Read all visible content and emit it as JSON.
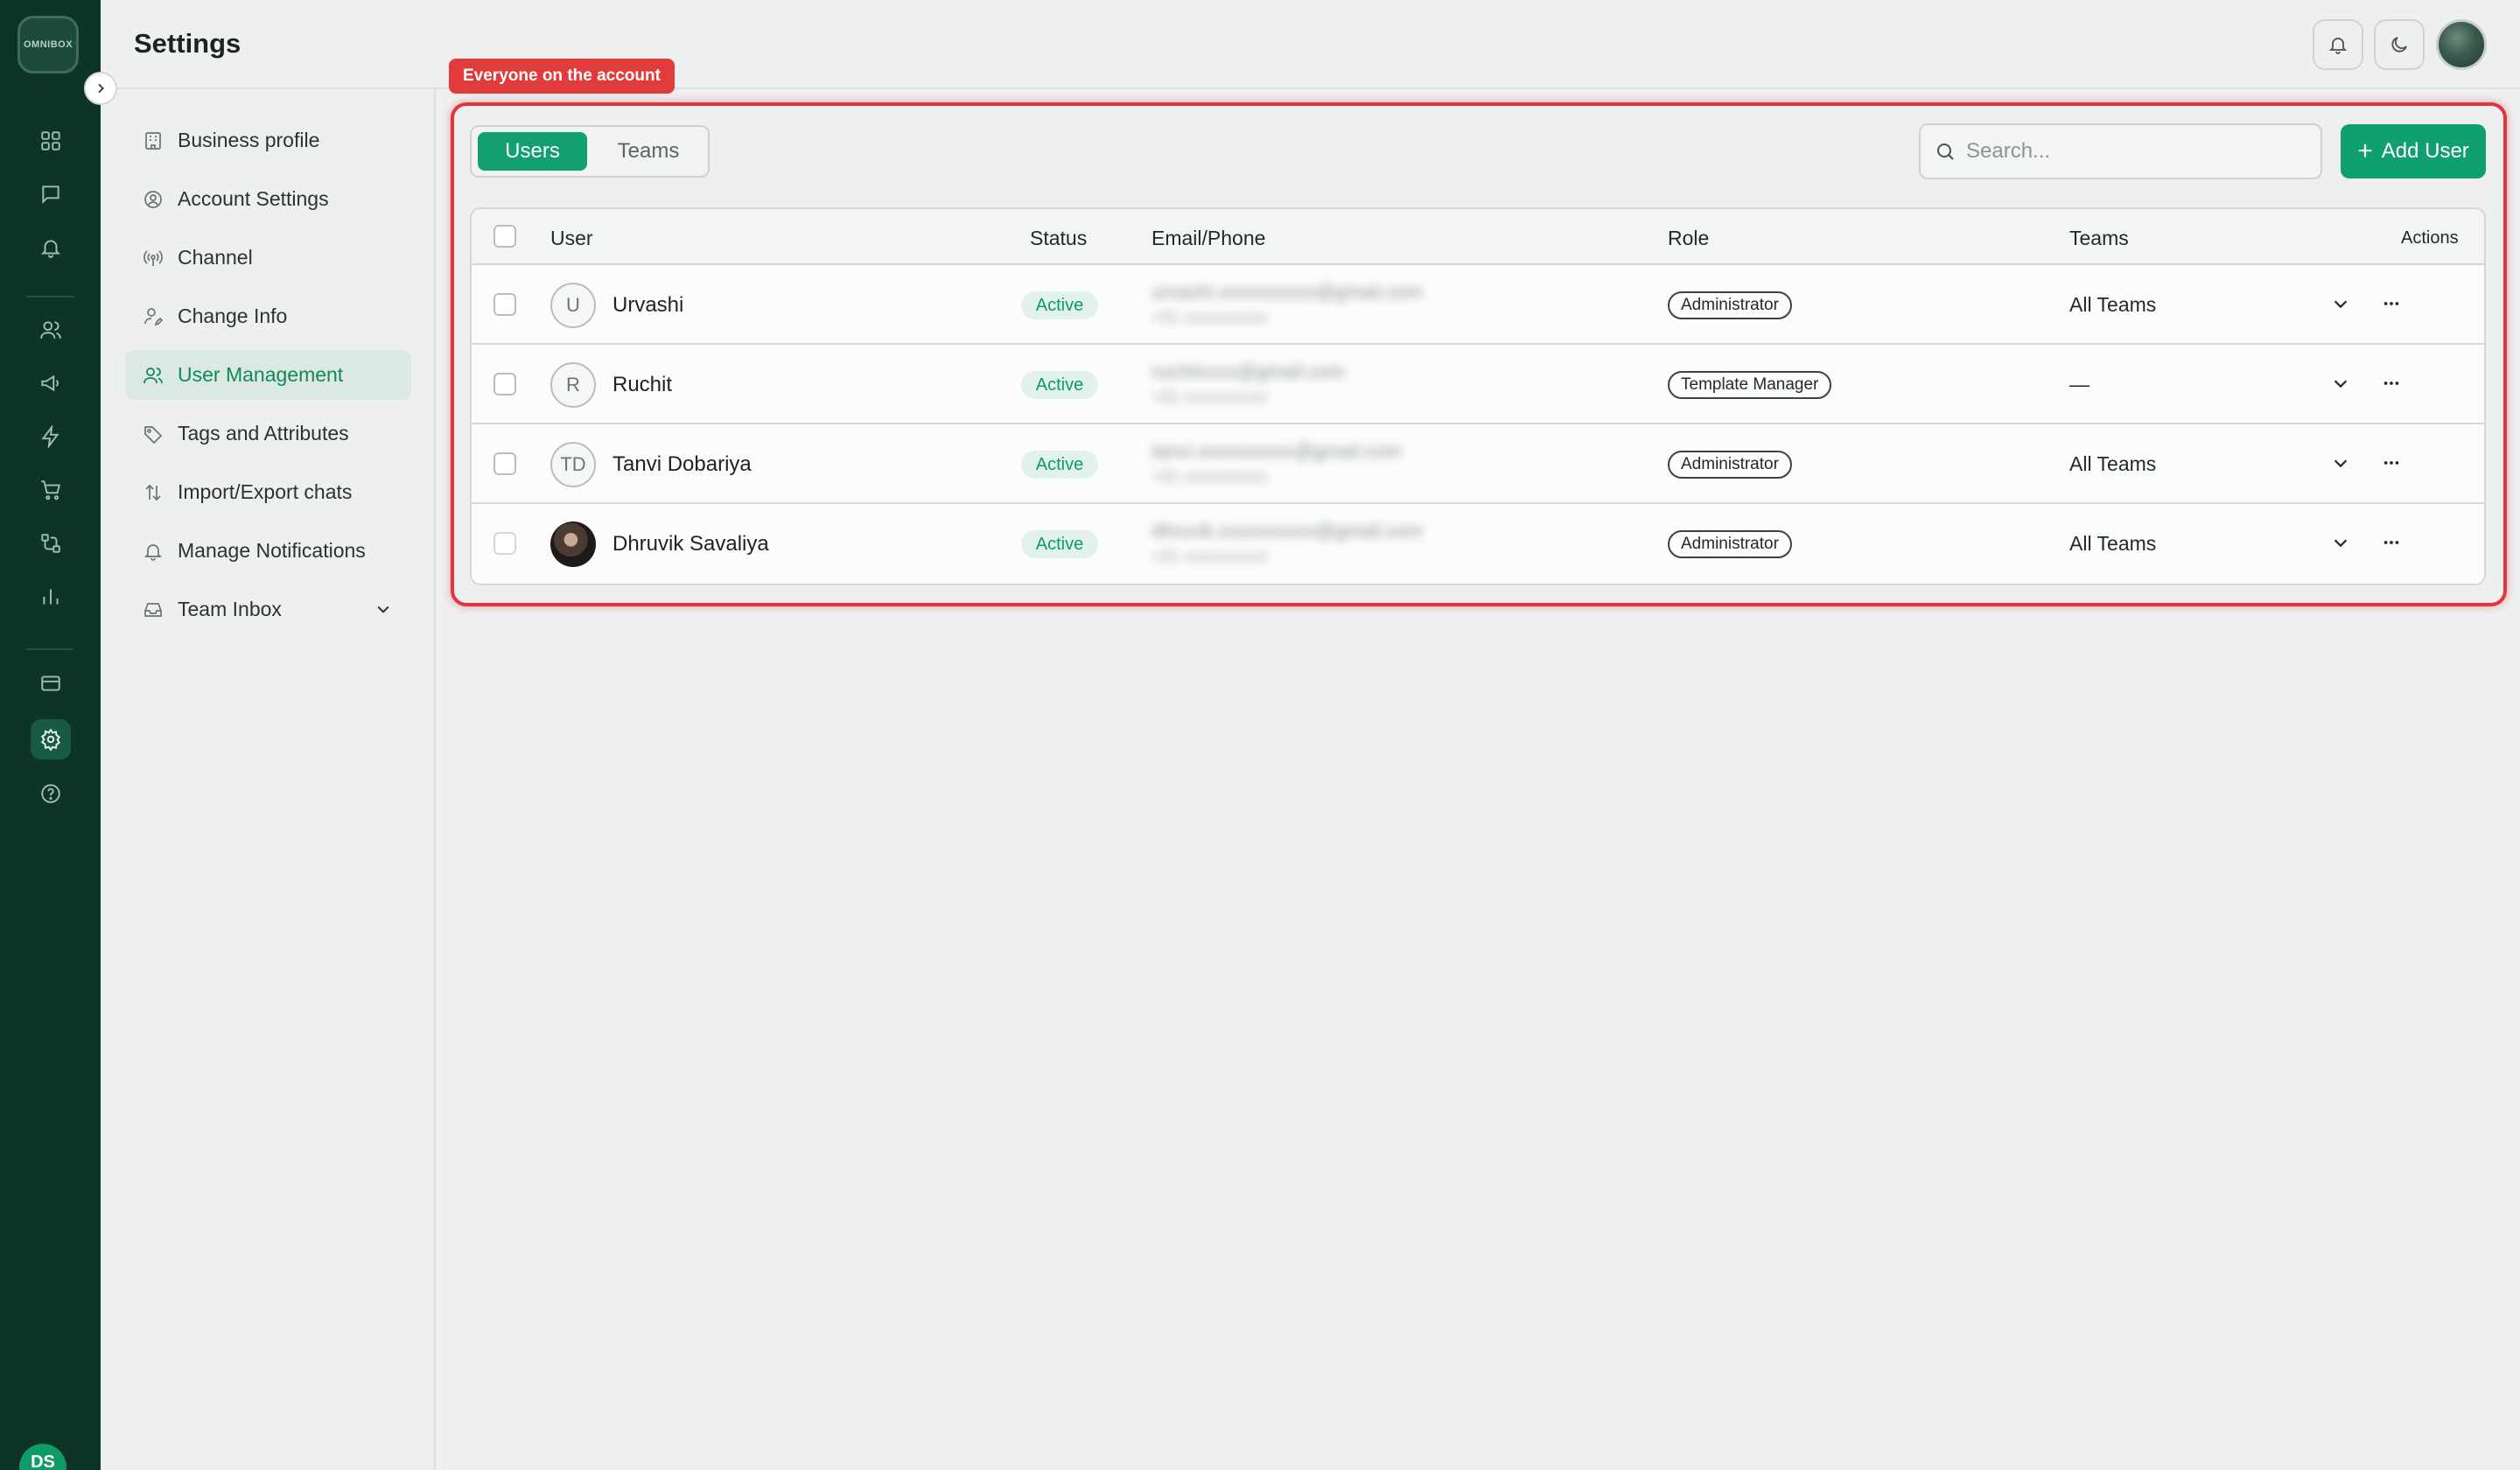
{
  "app": {
    "logo_text": "OMNIBOX",
    "rail_user_initials": "DS"
  },
  "header": {
    "title": "Settings"
  },
  "settings_menu": [
    {
      "label": "Business profile",
      "icon": "building-icon"
    },
    {
      "label": "Account Settings",
      "icon": "user-circle-icon"
    },
    {
      "label": "Channel",
      "icon": "broadcast-icon"
    },
    {
      "label": "Change Info",
      "icon": "user-edit-icon"
    },
    {
      "label": "User Management",
      "icon": "users-icon",
      "active": true
    },
    {
      "label": "Tags and Attributes",
      "icon": "tag-icon"
    },
    {
      "label": "Import/Export chats",
      "icon": "arrows-updown-icon"
    },
    {
      "label": "Manage Notifications",
      "icon": "bell-icon"
    },
    {
      "label": "Team Inbox",
      "icon": "inbox-icon",
      "has_dropdown": true
    }
  ],
  "tooltip": "Everyone on the account",
  "tabs": {
    "users": "Users",
    "teams": "Teams",
    "selected": "Users"
  },
  "search": {
    "placeholder": "Search..."
  },
  "add_button": {
    "label": "Add User"
  },
  "table": {
    "columns": {
      "user": "User",
      "status": "Status",
      "email_phone": "Email/Phone",
      "role": "Role",
      "teams": "Teams",
      "actions": "Actions"
    },
    "rows": [
      {
        "initials": "U",
        "name": "Urvashi",
        "status": "Active",
        "email": "urvashi.xxxxxxxxxx@gmail.com",
        "phone": "+91 xxxxxxxxxx",
        "role": "Administrator",
        "teams": "All Teams"
      },
      {
        "initials": "R",
        "name": "Ruchit",
        "status": "Active",
        "email": "ruchitxxxx@gmail.com",
        "phone": "+91 xxxxxxxxxx",
        "role": "Template Manager",
        "teams": "—"
      },
      {
        "initials": "TD",
        "name": "Tanvi Dobariya",
        "status": "Active",
        "email": "tanvi.xxxxxxxxxx@gmail.com",
        "phone": "+91 xxxxxxxxxx",
        "role": "Administrator",
        "teams": "All Teams"
      },
      {
        "initials": "",
        "name": "Dhruvik Savaliya",
        "status": "Active",
        "email": "dhruvik.xxxxxxxxxx@gmail.com",
        "phone": "+91 xxxxxxxxxx",
        "role": "Administrator",
        "teams": "All Teams",
        "has_photo": true
      }
    ]
  },
  "colors": {
    "brand": "#10a06d",
    "rail": "#0e3327",
    "highlight": "#e2343c"
  }
}
